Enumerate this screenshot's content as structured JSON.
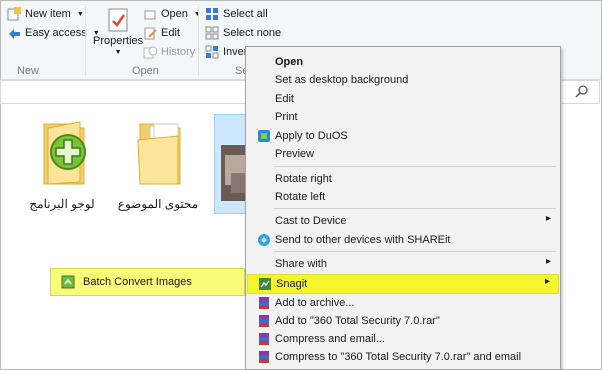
{
  "ribbon": {
    "new_item": "New item",
    "easy_access": "Easy access",
    "new_group": "New",
    "properties": "Properties",
    "open": "Open",
    "edit": "Edit",
    "history": "History",
    "open_group": "Open",
    "select_all": "Select all",
    "select_none": "Select none",
    "invert": "Invert",
    "select_group": "Se"
  },
  "files": [
    {
      "caption": "لوجو البرنامج"
    },
    {
      "caption": "محتوى الموضوع"
    }
  ],
  "submenu": {
    "label": "Batch Convert Images"
  },
  "menu": {
    "items": [
      {
        "label": "Open",
        "bold": true
      },
      {
        "label": "Set as desktop background"
      },
      {
        "label": "Edit"
      },
      {
        "label": "Print"
      },
      {
        "label": "Apply to DuOS",
        "icon": "duos-icon"
      },
      {
        "label": "Preview"
      },
      {
        "label": "Rotate right"
      },
      {
        "label": "Rotate left"
      },
      {
        "label": "Cast to Device",
        "arrow": true
      },
      {
        "label": "Send to other devices with SHAREit",
        "icon": "shareit-icon"
      },
      {
        "label": "Share with",
        "arrow": true
      },
      {
        "label": "Snagit",
        "arrow": true,
        "icon": "snagit-icon"
      },
      {
        "label": "Add to archive...",
        "icon": "winrar-icon"
      },
      {
        "label": "Add to \"360 Total Security 7.0.rar\"",
        "icon": "winrar-icon"
      },
      {
        "label": "Compress and email...",
        "icon": "winrar-icon"
      },
      {
        "label": "Compress to \"360 Total Security 7.0.rar\" and email",
        "icon": "winrar-icon"
      }
    ]
  },
  "colors": {
    "highlight": "#ffff66",
    "menu_bg": "#f2f2f2",
    "selection": "#cce8ff"
  }
}
